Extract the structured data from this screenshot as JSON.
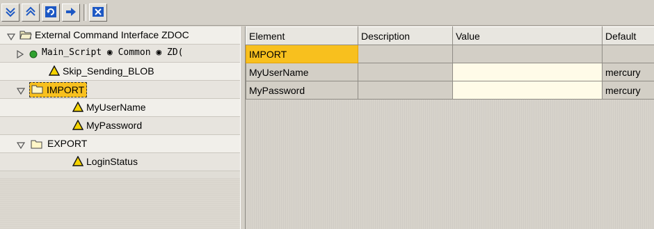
{
  "toolbar": {
    "buttons": [
      {
        "icon": "expand-down-icon"
      },
      {
        "icon": "collapse-up-icon"
      },
      {
        "icon": "refresh-icon"
      },
      {
        "icon": "arrow-right-icon"
      },
      {
        "icon": "close-x-icon"
      }
    ]
  },
  "tree": {
    "root": {
      "label": "External Command Interface ZDOC"
    },
    "main_script": {
      "label": "Main_Script",
      "common": "Common",
      "zd": "ZD("
    },
    "skip": {
      "label": "Skip_Sending_BLOB"
    },
    "import": {
      "label": "IMPORT"
    },
    "import_children": [
      "MyUserName",
      "MyPassword"
    ],
    "export": {
      "label": "EXPORT"
    },
    "export_children": [
      "LoginStatus"
    ]
  },
  "grid": {
    "columns": [
      "Element",
      "Description",
      "Value",
      "Default"
    ],
    "rows": [
      [
        "IMPORT",
        "",
        "",
        ""
      ],
      [
        "MyUserName",
        "",
        "",
        "mercury"
      ],
      [
        "MyPassword",
        "",
        "",
        "mercury"
      ]
    ]
  },
  "colors": {
    "selection": "#f8c01e",
    "toolbar_blue": "#1d58c4",
    "panel": "#d4d0c8"
  }
}
